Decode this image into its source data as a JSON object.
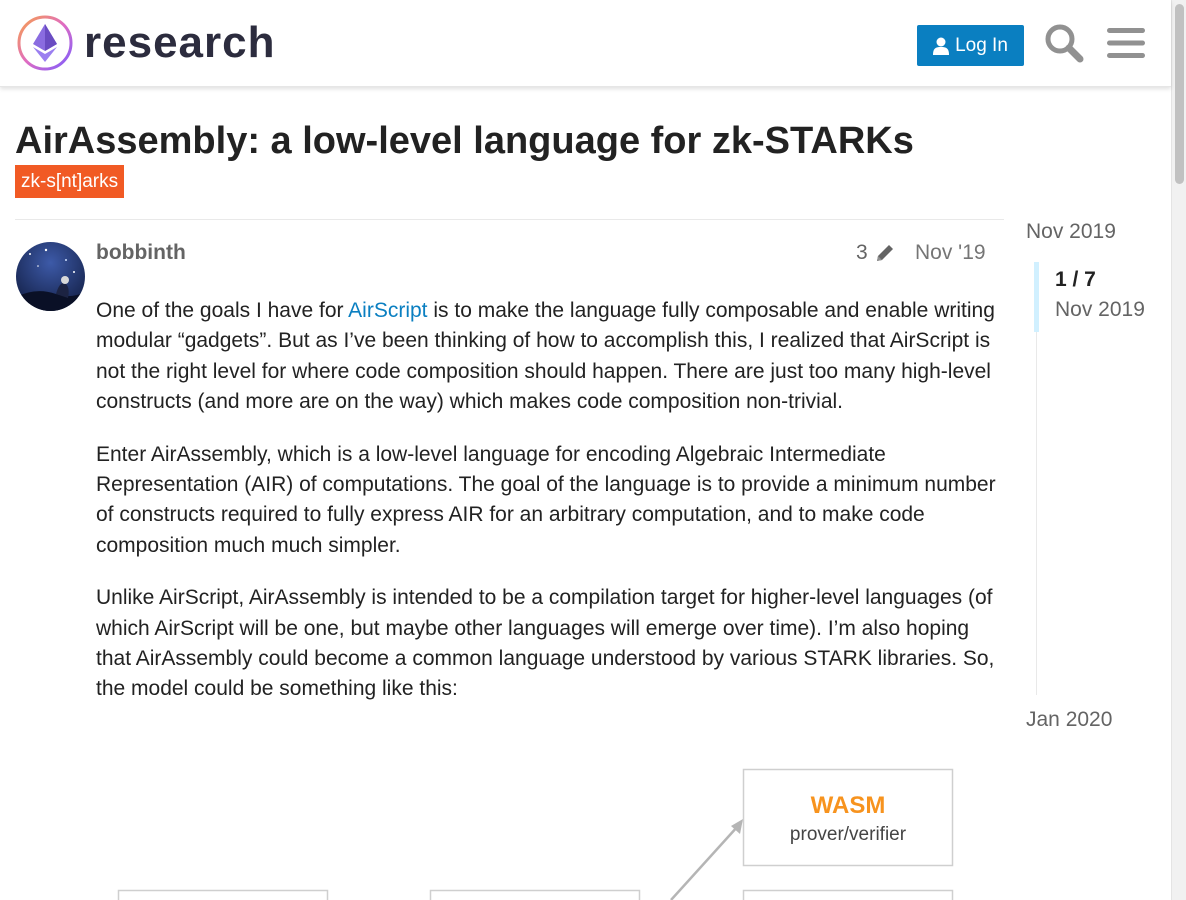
{
  "header": {
    "site_name": "research",
    "login_label": "Log In"
  },
  "topic": {
    "title": "AirAssembly: a low-level language for zk-STARKs",
    "tag": "zk-s[nt]arks"
  },
  "post": {
    "username": "bobbinth",
    "edit_count": "3",
    "date": "Nov '19",
    "p1_before": "One of the goals I have for ",
    "p1_link": "AirScript",
    "p1_after": " is to make the language fully composable and enable writing modular “gadgets”. But as I’ve been thinking of how to accomplish this, I realized that AirScript is not the right level for where code composition should happen. There are just too many high-level constructs (and more are on the way) which makes code composition non-trivial.",
    "p2": "Enter AirAssembly, which is a low-level language for encoding Algebraic Intermediate Representation (AIR) of computations. The goal of the language is to provide a minimum number of constructs required to fully express AIR for an arbitrary computation, and to make code composition much much simpler.",
    "p3": "Unlike AirScript, AirAssembly is intended to be a compilation target for higher-level languages (of which AirScript will be one, but maybe other languages will emerge over time). I’m also hoping that AirAssembly could become a common language understood by various STARK libraries. So, the model could be something like this:",
    "diagram": {
      "box_title": "WASM",
      "box_subtitle": "prover/verifier"
    }
  },
  "timeline": {
    "start": "Nov 2019",
    "position": "1 / 7",
    "position_date": "Nov 2019",
    "end": "Jan 2020"
  },
  "colors": {
    "accent": "#0a7fc1",
    "tag": "#f15a24",
    "wasm": "#f7931e"
  }
}
